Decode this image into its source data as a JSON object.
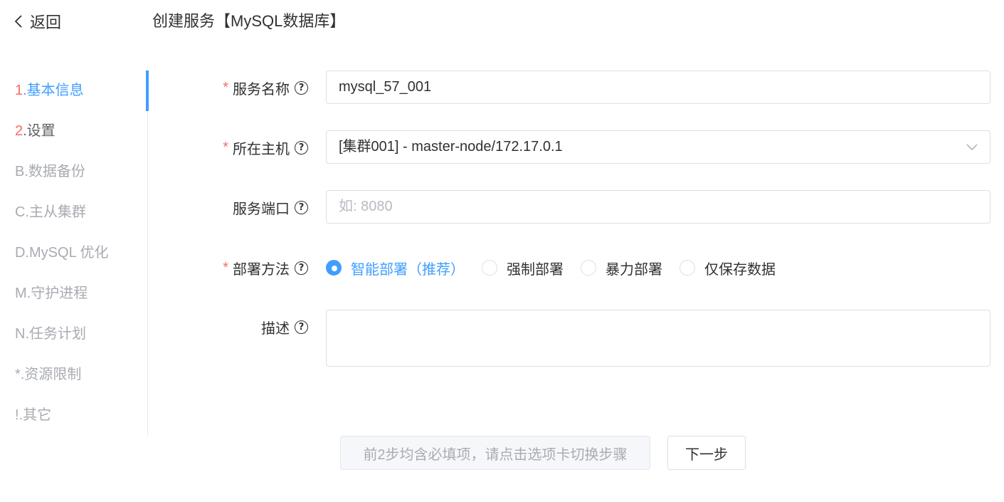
{
  "header": {
    "back_label": "返回",
    "title": "创建服务【MySQL数据库】"
  },
  "steps": [
    {
      "num": "1",
      "label": ".基本信息",
      "state": "active"
    },
    {
      "num": "2",
      "label": ".设置",
      "state": "todo"
    },
    {
      "num": "B",
      "label": ".数据备份",
      "state": "optional"
    },
    {
      "num": "C",
      "label": ".主从集群",
      "state": "optional"
    },
    {
      "num": "D",
      "label": ".MySQL 优化",
      "state": "optional"
    },
    {
      "num": "M",
      "label": ".守护进程",
      "state": "optional"
    },
    {
      "num": "N",
      "label": ".任务计划",
      "state": "optional"
    },
    {
      "num": "*",
      "label": ".资源限制",
      "state": "optional"
    },
    {
      "num": "!",
      "label": ".其它",
      "state": "optional"
    }
  ],
  "form": {
    "service_name": {
      "label": "服务名称",
      "required": true,
      "value": "mysql_57_001"
    },
    "host": {
      "label": "所在主机",
      "required": true,
      "value": "[集群001] - master-node/172.17.0.1"
    },
    "port": {
      "label": "服务端口",
      "required": false,
      "value": "",
      "placeholder": "如: 8080"
    },
    "deploy_method": {
      "label": "部署方法",
      "required": true,
      "options": [
        "智能部署（推荐）",
        "强制部署",
        "暴力部署",
        "仅保存数据"
      ],
      "selected": 0
    },
    "description": {
      "label": "描述",
      "required": false,
      "value": ""
    },
    "required_mark": "*",
    "help_glyph": "?"
  },
  "buttons": {
    "hint": "前2步均含必填项，请点击选项卡切换步骤",
    "next": "下一步"
  },
  "colors": {
    "primary": "#409eff",
    "required": "#f56c6c",
    "muted": "#a8abb2"
  }
}
